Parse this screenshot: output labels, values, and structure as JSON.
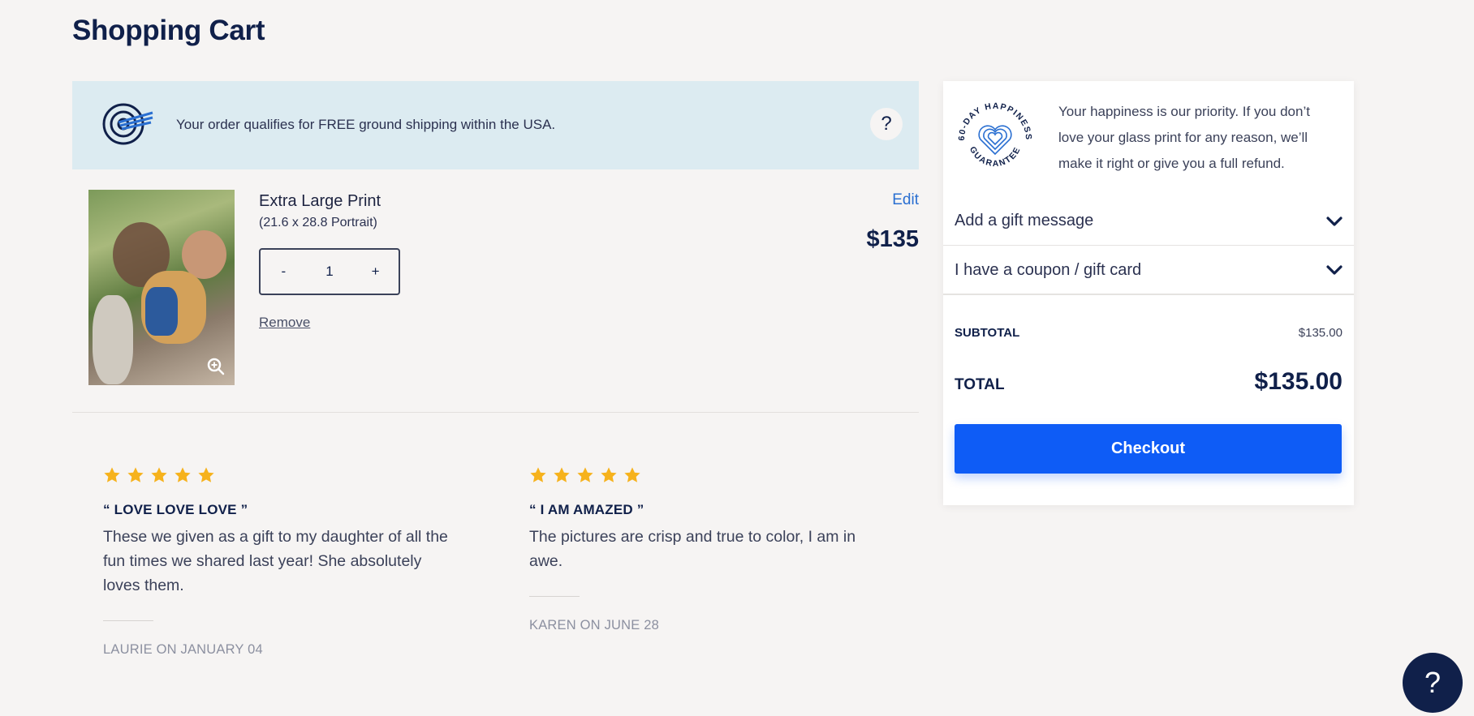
{
  "page": {
    "title": "Shopping Cart"
  },
  "shipping": {
    "message": "Your order qualifies for FREE ground shipping within the USA.",
    "help_label": "?"
  },
  "item": {
    "name": "Extra Large Print",
    "size": "(21.6 x 28.8 Portrait)",
    "quantity": "1",
    "minus_label": "-",
    "plus_label": "+",
    "remove_label": "Remove",
    "edit_label": "Edit",
    "price": "$135"
  },
  "reviews": [
    {
      "rating": 5,
      "title": "“ LOVE LOVE LOVE ”",
      "body": "These we given as a gift to my daughter of all the fun times we shared last year! She absolutely loves them.",
      "author": "LAURIE ON JANUARY 04"
    },
    {
      "rating": 5,
      "title": "“ I AM AMAZED ”",
      "body": "The pictures are crisp and true to color, I am in awe.",
      "author": "KAREN ON JUNE 28"
    }
  ],
  "summary": {
    "badge_top": "60-DAY HAPPINESS",
    "badge_bottom": "GUARANTEE",
    "guarantee_text": "Your happiness is our priority. If you don’t love your glass print for any reason, we’ll make it right or give you a full refund.",
    "gift_message_label": "Add a gift message",
    "coupon_label": "I have a coupon / gift card",
    "subtotal_label": "SUBTOTAL",
    "subtotal_value": "$135.00",
    "total_label": "TOTAL",
    "total_value": "$135.00",
    "checkout_label": "Checkout"
  },
  "chat": {
    "label": "?"
  },
  "colors": {
    "accent": "#0e5cf6",
    "navy": "#10204a",
    "banner": "#dcebf1",
    "star": "#f6b21c",
    "link": "#2a6fd1"
  },
  "icons": [
    "shipping-globe-icon",
    "help-icon",
    "zoom-icon",
    "star-icon",
    "chevron-down-icon",
    "heart-guarantee-icon"
  ]
}
